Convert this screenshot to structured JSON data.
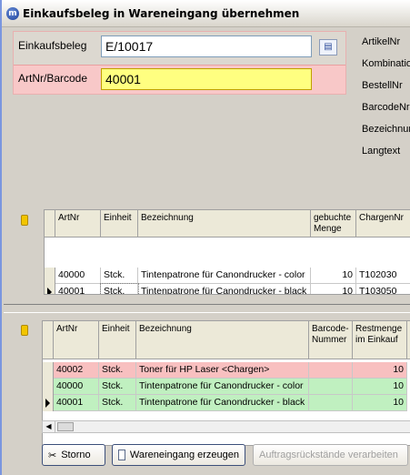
{
  "window": {
    "title": "Einkaufsbeleg in Wareneingang übernehmen",
    "icon": "app-logo-icon"
  },
  "form": {
    "einkaufsbeleg_label": "Einkaufsbeleg",
    "einkaufsbeleg_value": "E/10017",
    "artnr_label": "ArtNr/Barcode",
    "artnr_value": "40001"
  },
  "info_labels": [
    "ArtikelNr",
    "Kombination",
    "BestellNr",
    "BarcodeNr",
    "Bezeichnung",
    "Langtext"
  ],
  "grid1": {
    "headers": [
      "ArtNr",
      "Einheit",
      "Bezeichnung",
      "gebuchte Menge",
      "ChargenNr"
    ],
    "rows": [
      [
        "40000",
        "Stck.",
        "Tintenpatrone für Canondrucker - color",
        "10",
        "T102030"
      ],
      [
        "40001",
        "Stck.",
        "Tintenpatrone für Canondrucker - black",
        "10",
        "T103050"
      ]
    ]
  },
  "grid2": {
    "headers": [
      "ArtNr",
      "Einheit",
      "Bezeichnung",
      "Barcode-Nummer",
      "Restmenge im Einkauf"
    ],
    "rows": [
      [
        "40002",
        "Stck.",
        "Toner für HP Laser <Chargen>",
        "",
        "10"
      ],
      [
        "40000",
        "Stck.",
        "Tintenpatrone für Canondrucker - color",
        "",
        "10"
      ],
      [
        "40001",
        "Stck.",
        "Tintenpatrone für Canondrucker - black",
        "",
        "10"
      ]
    ],
    "row_colors": [
      "#f8c0c0",
      "#c0f0c0",
      "#c0f0c0"
    ]
  },
  "buttons": {
    "storno": "Storno",
    "wareneingang": "Wareneingang erzeugen",
    "auftragsrueckstaende": "Auftragsrückstände verarbeiten"
  }
}
